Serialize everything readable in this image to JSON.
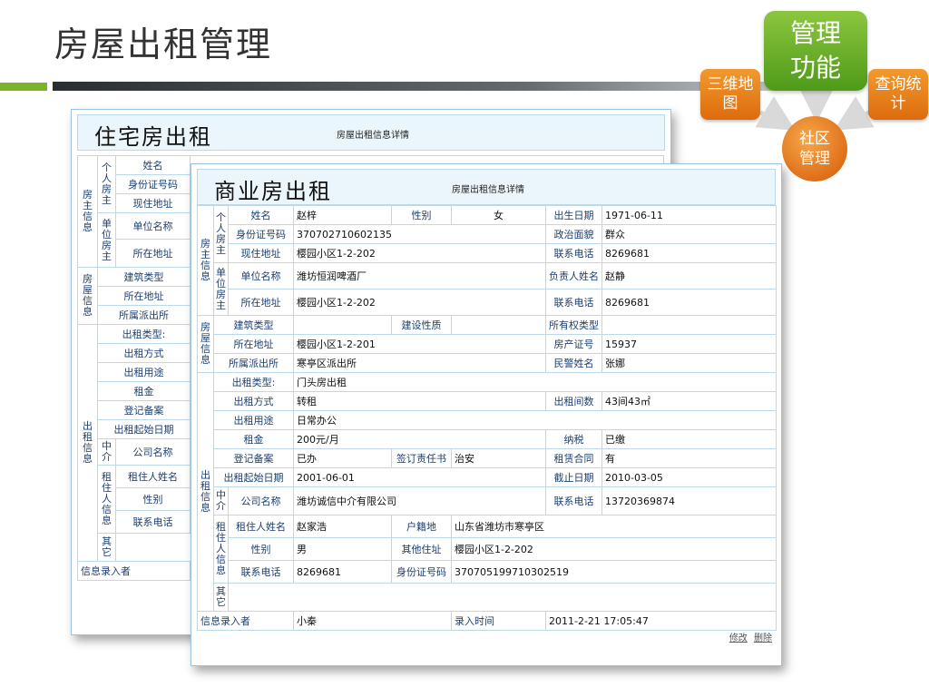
{
  "slide_title": "房屋出租管理",
  "nav": {
    "main": "管理\n功能",
    "left": "三维地\n图",
    "right": "查询统\n计",
    "center": "社区\n管理"
  },
  "residential": {
    "title": "住宅房出租",
    "rows": {
      "owner_group": "房\n主\n信\n息",
      "personal_group": "个\n人\n房\n主",
      "name": "姓名",
      "id_no": "身份证号码",
      "current_address": "现住地址",
      "unit_group": "单\n位\n房\n主",
      "unit_name": "单位名称",
      "address": "所在地址",
      "house_group": "房\n屋\n信\n息",
      "building_type": "建筑类型",
      "house_address": "所在地址",
      "police_station": "所属派出所",
      "rental_group": "出\n租\n信\n息",
      "rental_type": "出租类型:",
      "rental_method": "出租方式",
      "rental_use": "出租用途",
      "rent": "租金",
      "registration": "登记备案",
      "start_date": "出租起始日期",
      "agent_group": "中\n介",
      "company_name": "公司名称",
      "tenant_group": "租\n住\n人\n信\n息",
      "tenant_name": "租住人姓名",
      "gender": "性别",
      "phone": "联系电话",
      "other": "其\n它",
      "entered_by": "信息录入者"
    }
  },
  "commercial": {
    "title": "商业房出租",
    "subtitle": "房屋出租信息详情",
    "owner_group": "房\n主\n信\n息",
    "personal_group": "个\n人\n房\n主",
    "unit_group": "单\n位\n房\n主",
    "house_group": "房\n屋\n信\n息",
    "rental_group": "出\n租\n信\n息",
    "agent_group": "中\n介",
    "tenant_group": "租\n住\n人\n信\n息",
    "other_group": "其\n它",
    "labels": {
      "name": "姓名",
      "gender": "性别",
      "birth": "出生日期",
      "id_no": "身份证号码",
      "political": "政治面貌",
      "current_address": "现住地址",
      "phone": "联系电话",
      "unit_name": "单位名称",
      "principal": "负责人姓名",
      "address": "所在地址",
      "building_type": "建筑类型",
      "build_nature": "建设性质",
      "ownership": "所有权类型",
      "house_address": "所在地址",
      "property_cert": "房产证号",
      "police_station": "所属派出所",
      "police_name": "民警姓名",
      "rental_type": "出租类型:",
      "rental_method": "出租方式",
      "rental_rooms": "出租间数",
      "rental_use": "出租用途",
      "rent": "租金",
      "tax": "纳税",
      "registration": "登记备案",
      "security_signer": "签订责任书",
      "lease_contract": "租赁合同",
      "start_date": "出租起始日期",
      "end_date": "截止日期",
      "company_name": "公司名称",
      "tenant_name": "租住人姓名",
      "hukou": "户籍地",
      "other_address": "其他住址",
      "tenant_id": "身份证号码",
      "entered_by": "信息录入者",
      "entry_time": "录入时间"
    },
    "values": {
      "name": "赵梓",
      "gender": "女",
      "birth": "1971-06-11",
      "id_no": "370702710602135",
      "political": "群众",
      "current_address": "樱园小区1-2-202",
      "phone": "8269681",
      "unit_name": "潍坊恒润啤酒厂",
      "principal": "赵静",
      "unit_address": "樱园小区1-2-202",
      "unit_phone": "8269681",
      "house_address": "樱园小区1-2-201",
      "property_cert": "15937",
      "police_station": "寒亭区派出所",
      "police_name": "张娜",
      "rental_type": "门头房出租",
      "rental_method": "转租",
      "rental_rooms": "43间43㎡",
      "rental_use": "日常办公",
      "rent": "200元/月",
      "tax": "已缴",
      "registration": "已办",
      "security_signer": "治安",
      "lease_contract": "有",
      "start_date": "2001-06-01",
      "end_date": "2010-03-05",
      "company_name": "潍坊诚信中介有限公司",
      "company_phone": "13720369874",
      "tenant_name": "赵家浩",
      "hukou": "山东省潍坊市寒亭区",
      "tenant_gender": "男",
      "other_address": "樱园小区1-2-202",
      "tenant_phone": "8269681",
      "tenant_id": "370705199710302519",
      "entered_by": "小秦",
      "entry_time": "2011-2-21 17:05:47"
    },
    "actions": {
      "edit": "修改",
      "delete": "删除"
    }
  }
}
